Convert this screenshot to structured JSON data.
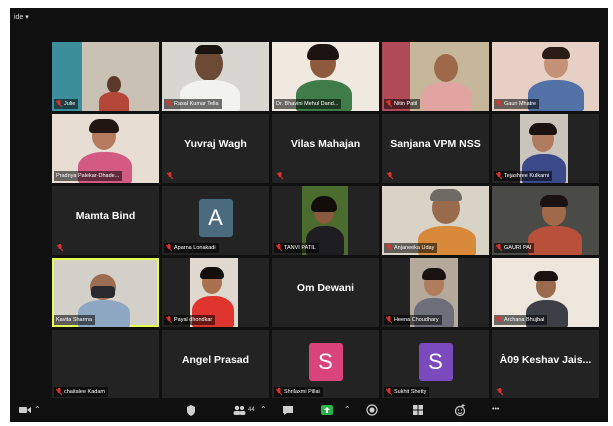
{
  "view": {
    "label": "ide ▾"
  },
  "participants": [
    {
      "name": "Julie",
      "mode": "video"
    },
    {
      "name": "Rasal Kumar Tella",
      "mode": "video"
    },
    {
      "name": "Dr. Bhavini Mehul Dand...",
      "mode": "video"
    },
    {
      "name": "Nitin Patil",
      "mode": "video"
    },
    {
      "name": "Gauri Mhatre",
      "mode": "video"
    },
    {
      "name": "Pradnya Palekar-Dhade...",
      "mode": "video"
    },
    {
      "display": "Yuvraj Wagh",
      "mode": "name"
    },
    {
      "display": "Vilas Mahajan",
      "mode": "name"
    },
    {
      "display": "Sanjana VPM NSS",
      "mode": "name"
    },
    {
      "name": "Tejashree Kulkarni",
      "mode": "video"
    },
    {
      "display": "Mamta Bind",
      "mode": "name"
    },
    {
      "name": "Aparna Lonakadi",
      "mode": "avatar",
      "initial": "A",
      "color": "#4a6b7e"
    },
    {
      "name": "TANVI PATIL",
      "mode": "video"
    },
    {
      "name": "Anjaneeka Uday",
      "mode": "video"
    },
    {
      "name": "GAURI PAI",
      "mode": "video"
    },
    {
      "name": "Kavita Sharma",
      "mode": "video",
      "active": true
    },
    {
      "name": "Payal dhondkar",
      "mode": "video"
    },
    {
      "display": "Om Dewani",
      "mode": "name"
    },
    {
      "name": "Heena Choudhary",
      "mode": "video"
    },
    {
      "name": "Archana Bhujbal",
      "mode": "video"
    },
    {
      "name": "chaitalee Kadam",
      "mode": "label"
    },
    {
      "display": "Angel Prasad",
      "mode": "name"
    },
    {
      "name": "Shrilaxmi Pillai",
      "mode": "avatar",
      "initial": "S",
      "color": "#d9457a"
    },
    {
      "name": "Sukhit Shetty",
      "mode": "avatar",
      "initial": "S",
      "color": "#7b4bbd"
    },
    {
      "display": "À09 Keshav Jais...",
      "mode": "name"
    }
  ],
  "toolbar": {
    "participants_count": "44",
    "more_label": "•••"
  },
  "colors": {
    "accent_active": "#e6ff4f",
    "mic_muted": "#e0322c",
    "share_green": "#2bb24c"
  }
}
